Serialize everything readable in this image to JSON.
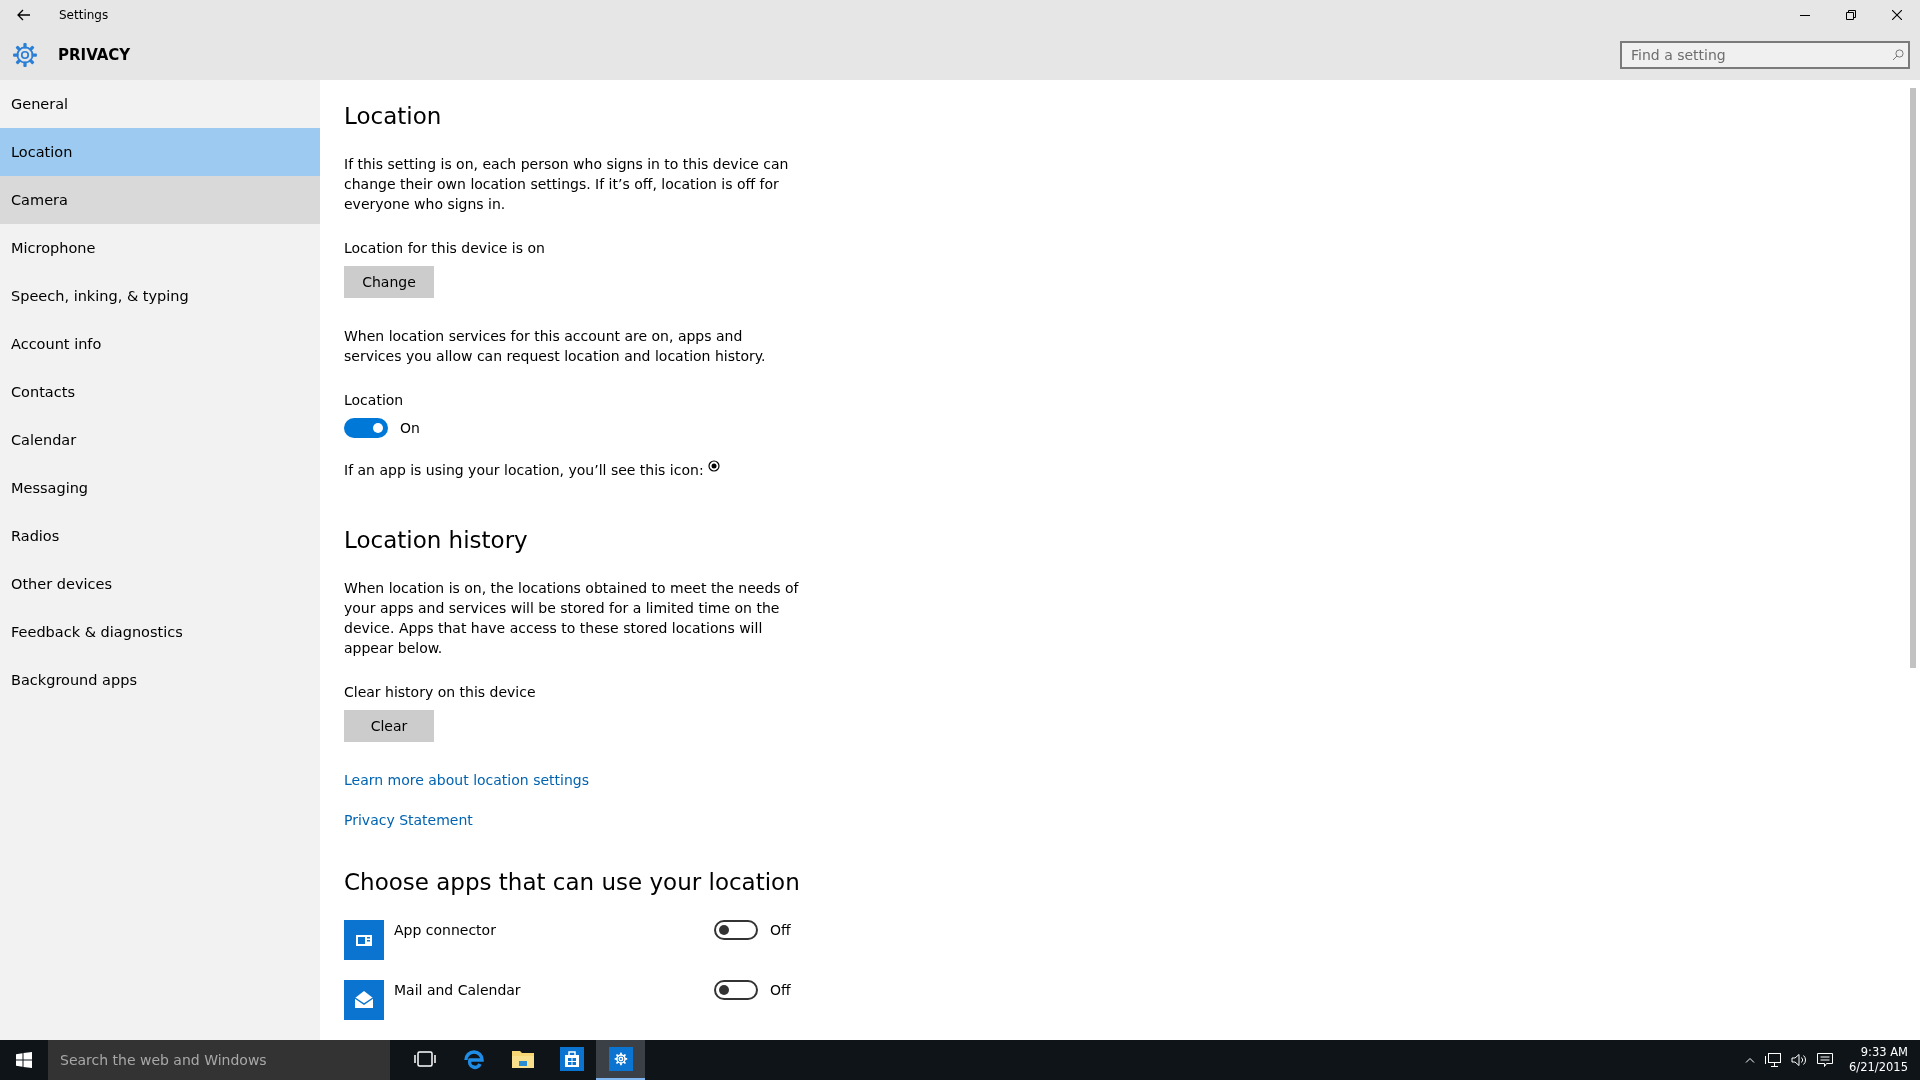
{
  "window": {
    "title": "Settings",
    "section": "PRIVACY"
  },
  "search": {
    "placeholder": "Find a setting"
  },
  "sidebar": {
    "items": [
      {
        "label": "General",
        "selected": false,
        "hovered": false
      },
      {
        "label": "Location",
        "selected": true,
        "hovered": false
      },
      {
        "label": "Camera",
        "selected": false,
        "hovered": true
      },
      {
        "label": "Microphone",
        "selected": false,
        "hovered": false
      },
      {
        "label": "Speech, inking, & typing",
        "selected": false,
        "hovered": false
      },
      {
        "label": "Account info",
        "selected": false,
        "hovered": false
      },
      {
        "label": "Contacts",
        "selected": false,
        "hovered": false
      },
      {
        "label": "Calendar",
        "selected": false,
        "hovered": false
      },
      {
        "label": "Messaging",
        "selected": false,
        "hovered": false
      },
      {
        "label": "Radios",
        "selected": false,
        "hovered": false
      },
      {
        "label": "Other devices",
        "selected": false,
        "hovered": false
      },
      {
        "label": "Feedback & diagnostics",
        "selected": false,
        "hovered": false
      },
      {
        "label": "Background apps",
        "selected": false,
        "hovered": false
      }
    ]
  },
  "content": {
    "blocks": [
      {
        "kind": "heading",
        "text": "Location"
      },
      {
        "kind": "paragraph",
        "text": "If this setting is on, each person who signs in to this device can change their own location settings. If it’s off, location is off for everyone who signs in."
      },
      {
        "kind": "label",
        "text": "Location for this device is on"
      },
      {
        "kind": "button",
        "text": "Change"
      },
      {
        "kind": "paragraph",
        "text": "When location services for this account are on, apps and services you allow can request location and location history."
      },
      {
        "kind": "toggle",
        "label": "Location",
        "state": "On",
        "on": true
      },
      {
        "kind": "icon_note",
        "text": "If an app is using your location, you’ll see this icon:"
      },
      {
        "kind": "heading",
        "text": "Location history"
      },
      {
        "kind": "paragraph",
        "text": "When location is on, the locations obtained to meet the needs of your apps and services will be stored for a limited time on the device. Apps that have access to these stored locations will appear below."
      },
      {
        "kind": "label",
        "text": "Clear history on this device"
      },
      {
        "kind": "button",
        "text": "Clear"
      },
      {
        "kind": "link",
        "text": "Learn more about location settings"
      },
      {
        "kind": "link",
        "text": "Privacy Statement"
      },
      {
        "kind": "heading",
        "text": "Choose apps that can use your location"
      },
      {
        "kind": "app",
        "name": "App connector",
        "state": "Off",
        "on": false
      },
      {
        "kind": "app",
        "name": "Mail and Calendar",
        "state": "Off",
        "on": false
      }
    ]
  },
  "taskbar": {
    "search_placeholder": "Search the web and Windows",
    "apps": [
      {
        "kind": "task-view",
        "selected": false
      },
      {
        "kind": "edge",
        "selected": false
      },
      {
        "kind": "explorer",
        "selected": false
      },
      {
        "kind": "store",
        "selected": false
      },
      {
        "kind": "settings",
        "selected": true
      }
    ],
    "time": "9:33 AM",
    "date": "6/21/2015"
  }
}
